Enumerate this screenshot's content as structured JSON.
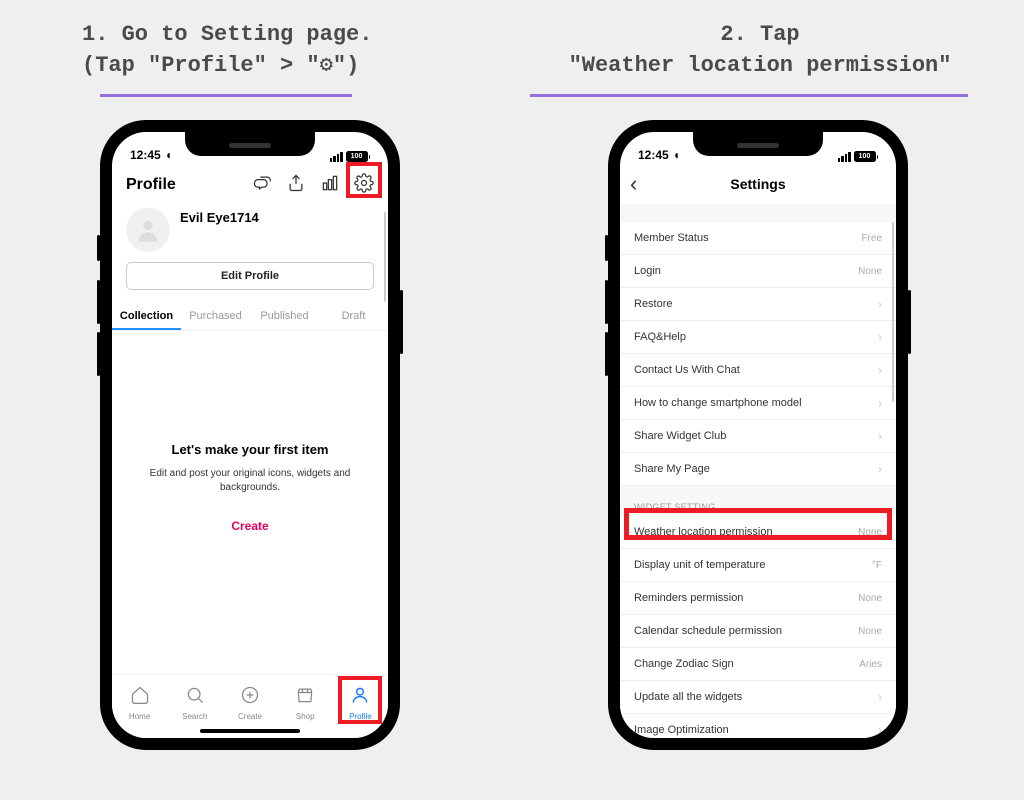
{
  "instructions": {
    "step1_line1": "1. Go to Setting page.",
    "step1_line2": "(Tap \"Profile\" > \"⚙\")",
    "step2_line1": "2. Tap",
    "step2_line2": "\"Weather location permission\""
  },
  "status": {
    "time": "12:45",
    "battery": "100"
  },
  "phone1": {
    "title": "Profile",
    "username": "Evil Eye1714",
    "edit_btn": "Edit Profile",
    "tabs": {
      "collection": "Collection",
      "purchased": "Purchased",
      "published": "Published",
      "draft": "Draft"
    },
    "empty": {
      "title": "Let's make your first item",
      "sub": "Edit and post your original icons, widgets and backgrounds.",
      "create": "Create"
    },
    "tabbar": {
      "home": "Home",
      "search": "Search",
      "create": "Create",
      "shop": "Shop",
      "profile": "Profile"
    }
  },
  "phone2": {
    "title": "Settings",
    "rows": {
      "member_status": {
        "label": "Member Status",
        "value": "Free"
      },
      "login": {
        "label": "Login",
        "value": "None"
      },
      "restore": {
        "label": "Restore"
      },
      "faq": {
        "label": "FAQ&Help"
      },
      "contact": {
        "label": "Contact Us With Chat"
      },
      "change_model": {
        "label": "How to change smartphone model"
      },
      "share_club": {
        "label": "Share Widget Club"
      },
      "share_page": {
        "label": "Share My Page"
      }
    },
    "section_widget": "WIDGET SETTING",
    "widget_rows": {
      "weather": {
        "label": "Weather location permission",
        "value": "None"
      },
      "temp": {
        "label": "Display unit of temperature",
        "value": "°F"
      },
      "reminders": {
        "label": "Reminders permission",
        "value": "None"
      },
      "calendar": {
        "label": "Calendar schedule permission",
        "value": "None"
      },
      "zodiac": {
        "label": "Change Zodiac Sign",
        "value": "Aries"
      },
      "update_widgets": {
        "label": "Update all the widgets"
      },
      "image_opt": {
        "label": "Image Optimization"
      }
    }
  }
}
